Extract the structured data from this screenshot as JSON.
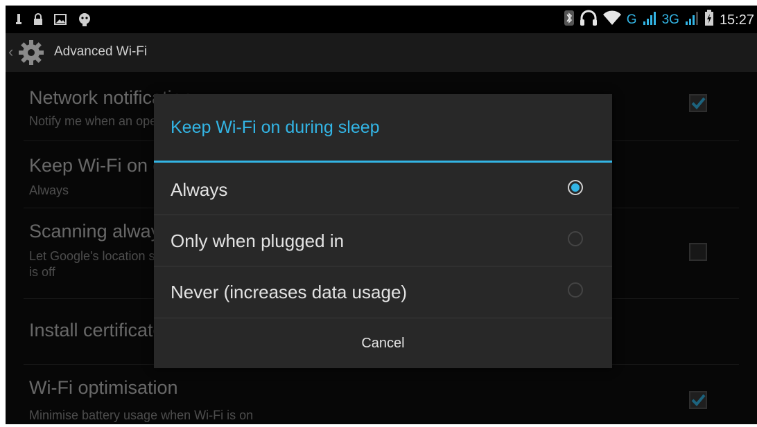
{
  "status_bar": {
    "time": "15:27",
    "network_g": "G",
    "network_3g": "3G",
    "icons": [
      "usb-icon",
      "lock-icon",
      "image-icon",
      "android-icon",
      "bluetooth-icon",
      "headset-icon",
      "wifi-icon",
      "signal-icon",
      "signal-icon",
      "battery-icon"
    ]
  },
  "action_bar": {
    "title": "Advanced Wi-Fi",
    "icon": "gear-icon"
  },
  "settings": {
    "network_notification": {
      "title": "Network notification",
      "summary": "Notify me when an open network is available",
      "checked": true
    },
    "keep_wifi_on": {
      "title": "Keep Wi-Fi on during sleep",
      "summary": "Always"
    },
    "scanning": {
      "title": "Scanning always available",
      "summary_line1": "Let Google's location service and other apps scan for networks, even when Wi-Fi",
      "summary_line2": "is off",
      "checked": false
    },
    "install_certificates": {
      "title": "Install certificates"
    },
    "wifi_optimisation": {
      "title": "Wi-Fi optimisation",
      "summary": "Minimise battery usage when Wi-Fi is on",
      "checked": true
    }
  },
  "dialog": {
    "title": "Keep Wi-Fi on during sleep",
    "options": [
      {
        "label": "Always",
        "selected": true
      },
      {
        "label": "Only when plugged in",
        "selected": false
      },
      {
        "label": "Never (increases data usage)",
        "selected": false
      }
    ],
    "cancel_label": "Cancel"
  },
  "colors": {
    "accent": "#33b5e5",
    "background": "#0e0e0e",
    "dialog_bg": "#282828"
  }
}
